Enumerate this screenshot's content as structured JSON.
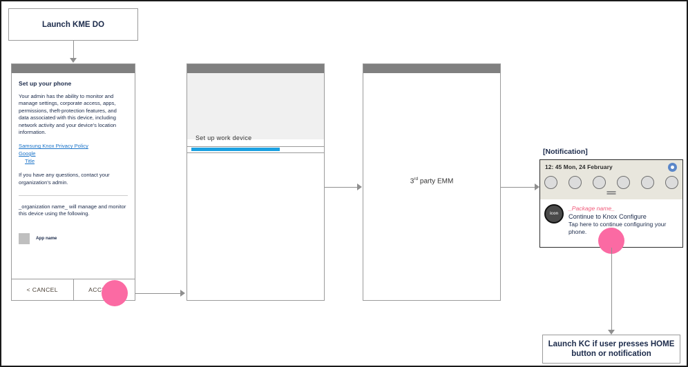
{
  "flow": {
    "launch_box": "Launch KME DO",
    "kc_box_line1": "Launch KC if user presses HOME",
    "kc_box_line2": "button or notification"
  },
  "screen1": {
    "title": "Set up your phone",
    "paragraph": "Your admin has the ability to monitor and manage settings, corporate access, apps, permissions, theft-protection features, and data associated with this device, including network activity and your device's location information.",
    "links": [
      "Samsung Knox Privacy Policy",
      "Google",
      "Title"
    ],
    "question_text": "If you have any questions, contact your organization's admin.",
    "manage_text": "_organization name_ will manage and monitor this device using the following.",
    "app_name": "App name",
    "cancel_label": "< CANCEL",
    "accept_label": "ACCEPT >"
  },
  "screen2": {
    "label": "Set up work device"
  },
  "screen3": {
    "label_prefix": "3",
    "label_sup": "rd",
    "label_suffix": " party EMM"
  },
  "notification": {
    "panel_label": "[Notification]",
    "time": "12: 45 Mon, 24 February",
    "package_name": "_Package name_",
    "title": "Continue to Knox Configure",
    "subtitle": "Tap here to continue configuring your phone.",
    "app_icon_text": "icon",
    "toggle_count": 6
  },
  "colors": {
    "accent_blue": "#1ba1e2",
    "link_blue": "#1a73c8",
    "tap_pink": "#fb6aa3",
    "package_pink": "#f05a7a",
    "topbar_gray": "#808080",
    "notif_header": "#e8e6dd"
  }
}
